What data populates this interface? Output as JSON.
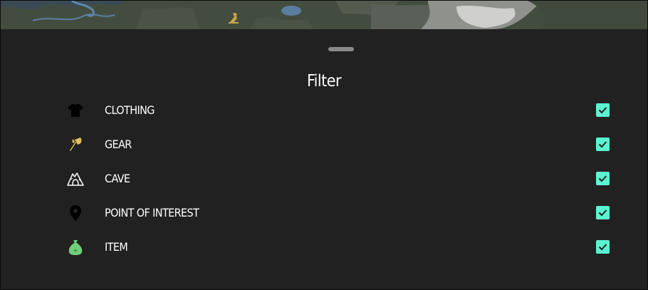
{
  "sheet": {
    "title": "Filter"
  },
  "filters": [
    {
      "label": "CLOTHING",
      "icon": "clothing-icon",
      "checked": true
    },
    {
      "label": "GEAR",
      "icon": "axe-icon",
      "checked": true
    },
    {
      "label": "CAVE",
      "icon": "cave-icon",
      "checked": true
    },
    {
      "label": "POINT OF INTEREST",
      "icon": "location-pin-icon",
      "checked": true
    },
    {
      "label": "ITEM",
      "icon": "money-bag-icon",
      "checked": true
    }
  ],
  "colors": {
    "background": "#212121",
    "checkbox": "#5cf3d1",
    "gear_icon": "#e2c15c",
    "item_icon": "#6fcf7a"
  }
}
